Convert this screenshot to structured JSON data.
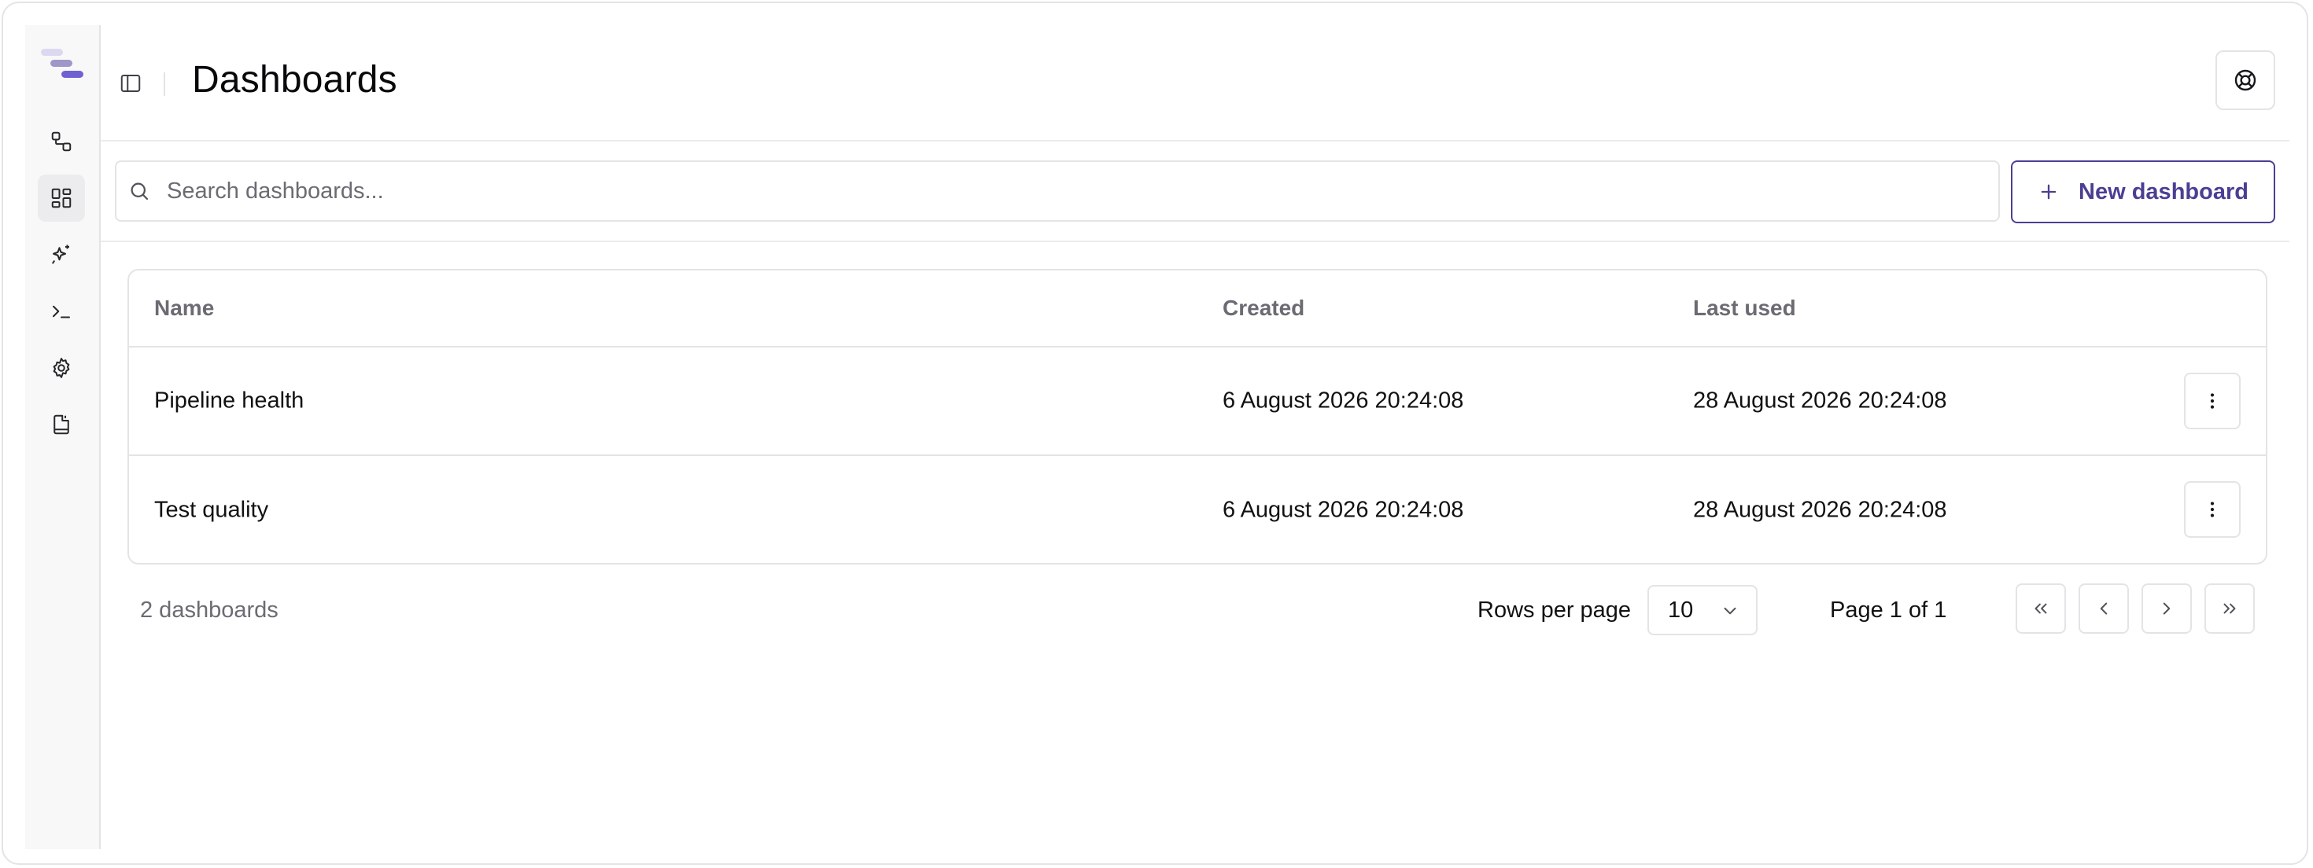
{
  "page": {
    "title": "Dashboards"
  },
  "sidebar": {
    "items": [
      {
        "icon": "workflow-icon"
      },
      {
        "icon": "dashboard-grid-icon",
        "active": true
      },
      {
        "icon": "sparkles-icon"
      },
      {
        "icon": "terminal-icon"
      },
      {
        "icon": "gear-icon"
      },
      {
        "icon": "book-icon"
      }
    ]
  },
  "toolbar": {
    "search_placeholder": "Search dashboards...",
    "new_button_label": "New dashboard"
  },
  "table": {
    "headers": {
      "name": "Name",
      "created": "Created",
      "last_used": "Last used"
    },
    "rows": [
      {
        "name": "Pipeline health",
        "created": "6 August 2026 20:24:08",
        "last_used": "28 August 2026 20:24:08"
      },
      {
        "name": "Test quality",
        "created": "6 August 2026 20:24:08",
        "last_used": "28 August 2026 20:24:08"
      }
    ]
  },
  "footer": {
    "count_label": "2 dashboards",
    "rows_per_page_label": "Rows per page",
    "rows_per_page_value": "10",
    "page_label": "Page 1 of 1"
  },
  "colors": {
    "accent": "#4b3f93",
    "logo_light": "#d8d4ee",
    "logo_mid": "#9b93c9",
    "logo_dark": "#6d5fd0"
  }
}
